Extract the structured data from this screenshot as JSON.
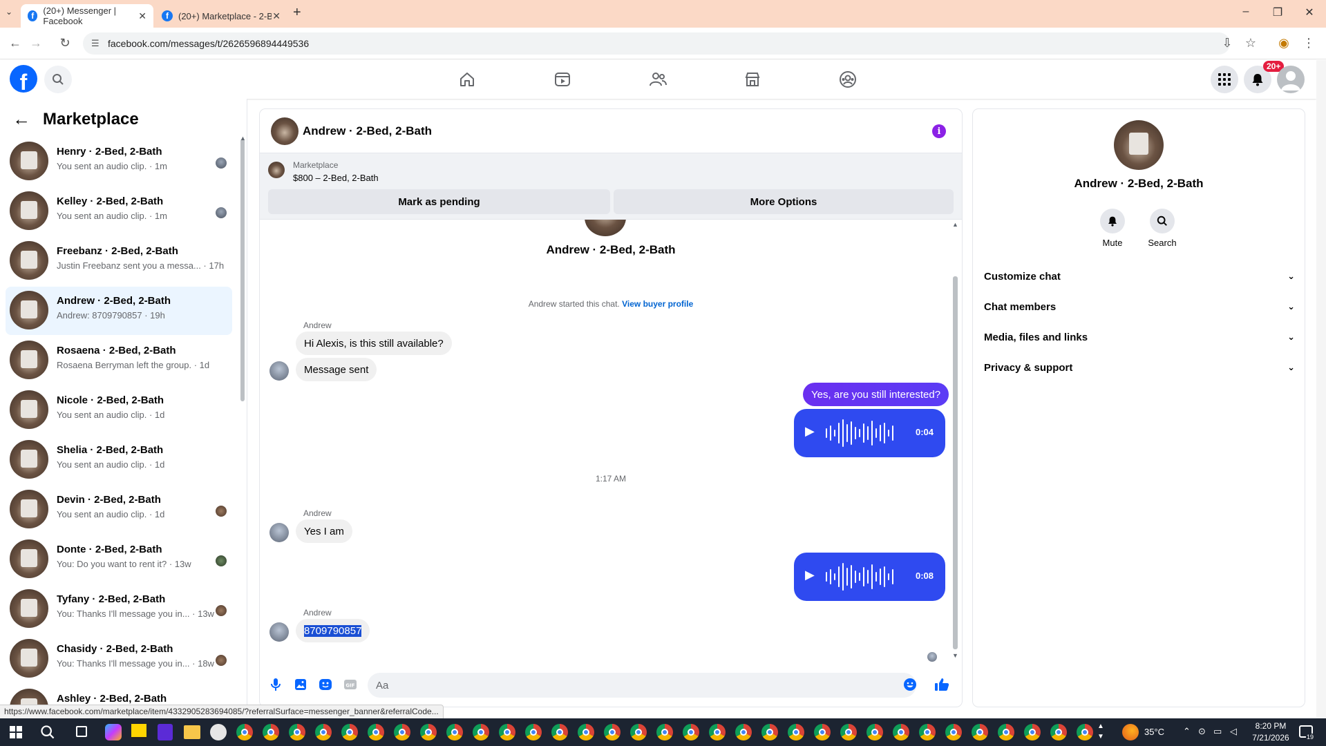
{
  "browser": {
    "tabs": [
      {
        "title": "(20+) Messenger | Facebook",
        "active": true
      },
      {
        "title": "(20+) Marketplace - 2-Bed, 2-B",
        "active": false
      }
    ],
    "url": "facebook.com/messages/t/2626596894449536",
    "status_url": "https://www.facebook.com/marketplace/item/4332905283694085/?referralSurface=messenger_banner&referralCode..."
  },
  "fb_nav": {
    "notification_badge": "20+",
    "icons": [
      "home-icon",
      "video-icon",
      "friends-icon",
      "marketplace-icon",
      "groups-icon"
    ]
  },
  "sidebar": {
    "title": "Marketplace",
    "conversations": [
      {
        "name": "Henry · 2-Bed, 2-Bath",
        "snippet": "You sent an audio clip. · 1m",
        "selected": false
      },
      {
        "name": "Kelley · 2-Bed, 2-Bath",
        "snippet": "You sent an audio clip. · 1m",
        "selected": false
      },
      {
        "name": "Freebanz · 2-Bed, 2-Bath",
        "snippet": "Justin Freebanz sent you a messa... · 17h",
        "selected": false
      },
      {
        "name": "Andrew · 2-Bed, 2-Bath",
        "snippet": "Andrew: 8709790857 · 19h",
        "selected": true
      },
      {
        "name": "Rosaena · 2-Bed, 2-Bath",
        "snippet": "Rosaena Berryman left the group. · 1d",
        "selected": false
      },
      {
        "name": "Nicole · 2-Bed, 2-Bath",
        "snippet": "You sent an audio clip. · 1d",
        "selected": false
      },
      {
        "name": "Shelia · 2-Bed, 2-Bath",
        "snippet": "You sent an audio clip. · 1d",
        "selected": false
      },
      {
        "name": "Devin · 2-Bed, 2-Bath",
        "snippet": "You sent an audio clip. · 1d",
        "selected": false
      },
      {
        "name": "Donte · 2-Bed, 2-Bath",
        "snippet": "You: Do you want to rent it? · 13w",
        "selected": false
      },
      {
        "name": "Tyfany · 2-Bed, 2-Bath",
        "snippet": "You: Thanks I'll message you in... · 13w",
        "selected": false
      },
      {
        "name": "Chasidy · 2-Bed, 2-Bath",
        "snippet": "You: Thanks I'll message you in... · 18w",
        "selected": false
      },
      {
        "name": "Ashley · 2-Bed, 2-Bath",
        "snippet": "",
        "selected": false
      }
    ]
  },
  "chat": {
    "title": "Andrew · 2-Bed, 2-Bath",
    "marketplace_label": "Marketplace",
    "listing": "$800 – 2-Bed, 2-Bath",
    "mark_pending_label": "Mark as pending",
    "more_options_label": "More Options",
    "peer_name": "Andrew · 2-Bed, 2-Bath",
    "started_text": "Andrew started this chat.",
    "view_buyer_profile": "View buyer profile",
    "sender": "Andrew",
    "messages": {
      "m1": "Hi Alexis, is this still available?",
      "m2": "Message sent",
      "out1": "Yes, are you still interested?",
      "audio1": "0:04",
      "timestamp": "1:17 AM",
      "m3": "Yes I am",
      "audio2": "0:08",
      "m4": "8709790857"
    },
    "composer_placeholder": "Aa"
  },
  "info_panel": {
    "name": "Andrew · 2-Bed, 2-Bath",
    "mute_label": "Mute",
    "search_label": "Search",
    "sections": [
      "Customize chat",
      "Chat members",
      "Media, files and links",
      "Privacy & support"
    ]
  },
  "taskbar": {
    "temperature": "35°C",
    "time": "8:20 PM",
    "date": "7/21/2026",
    "notif_count": "19"
  },
  "colors": {
    "fb_blue": "#0866ff",
    "outgoing_bubble": "#5b3cf5",
    "audio_bubble": "#2f4af0",
    "selected_conv": "#ebf5ff",
    "tabstrip": "#fbd9c6"
  }
}
